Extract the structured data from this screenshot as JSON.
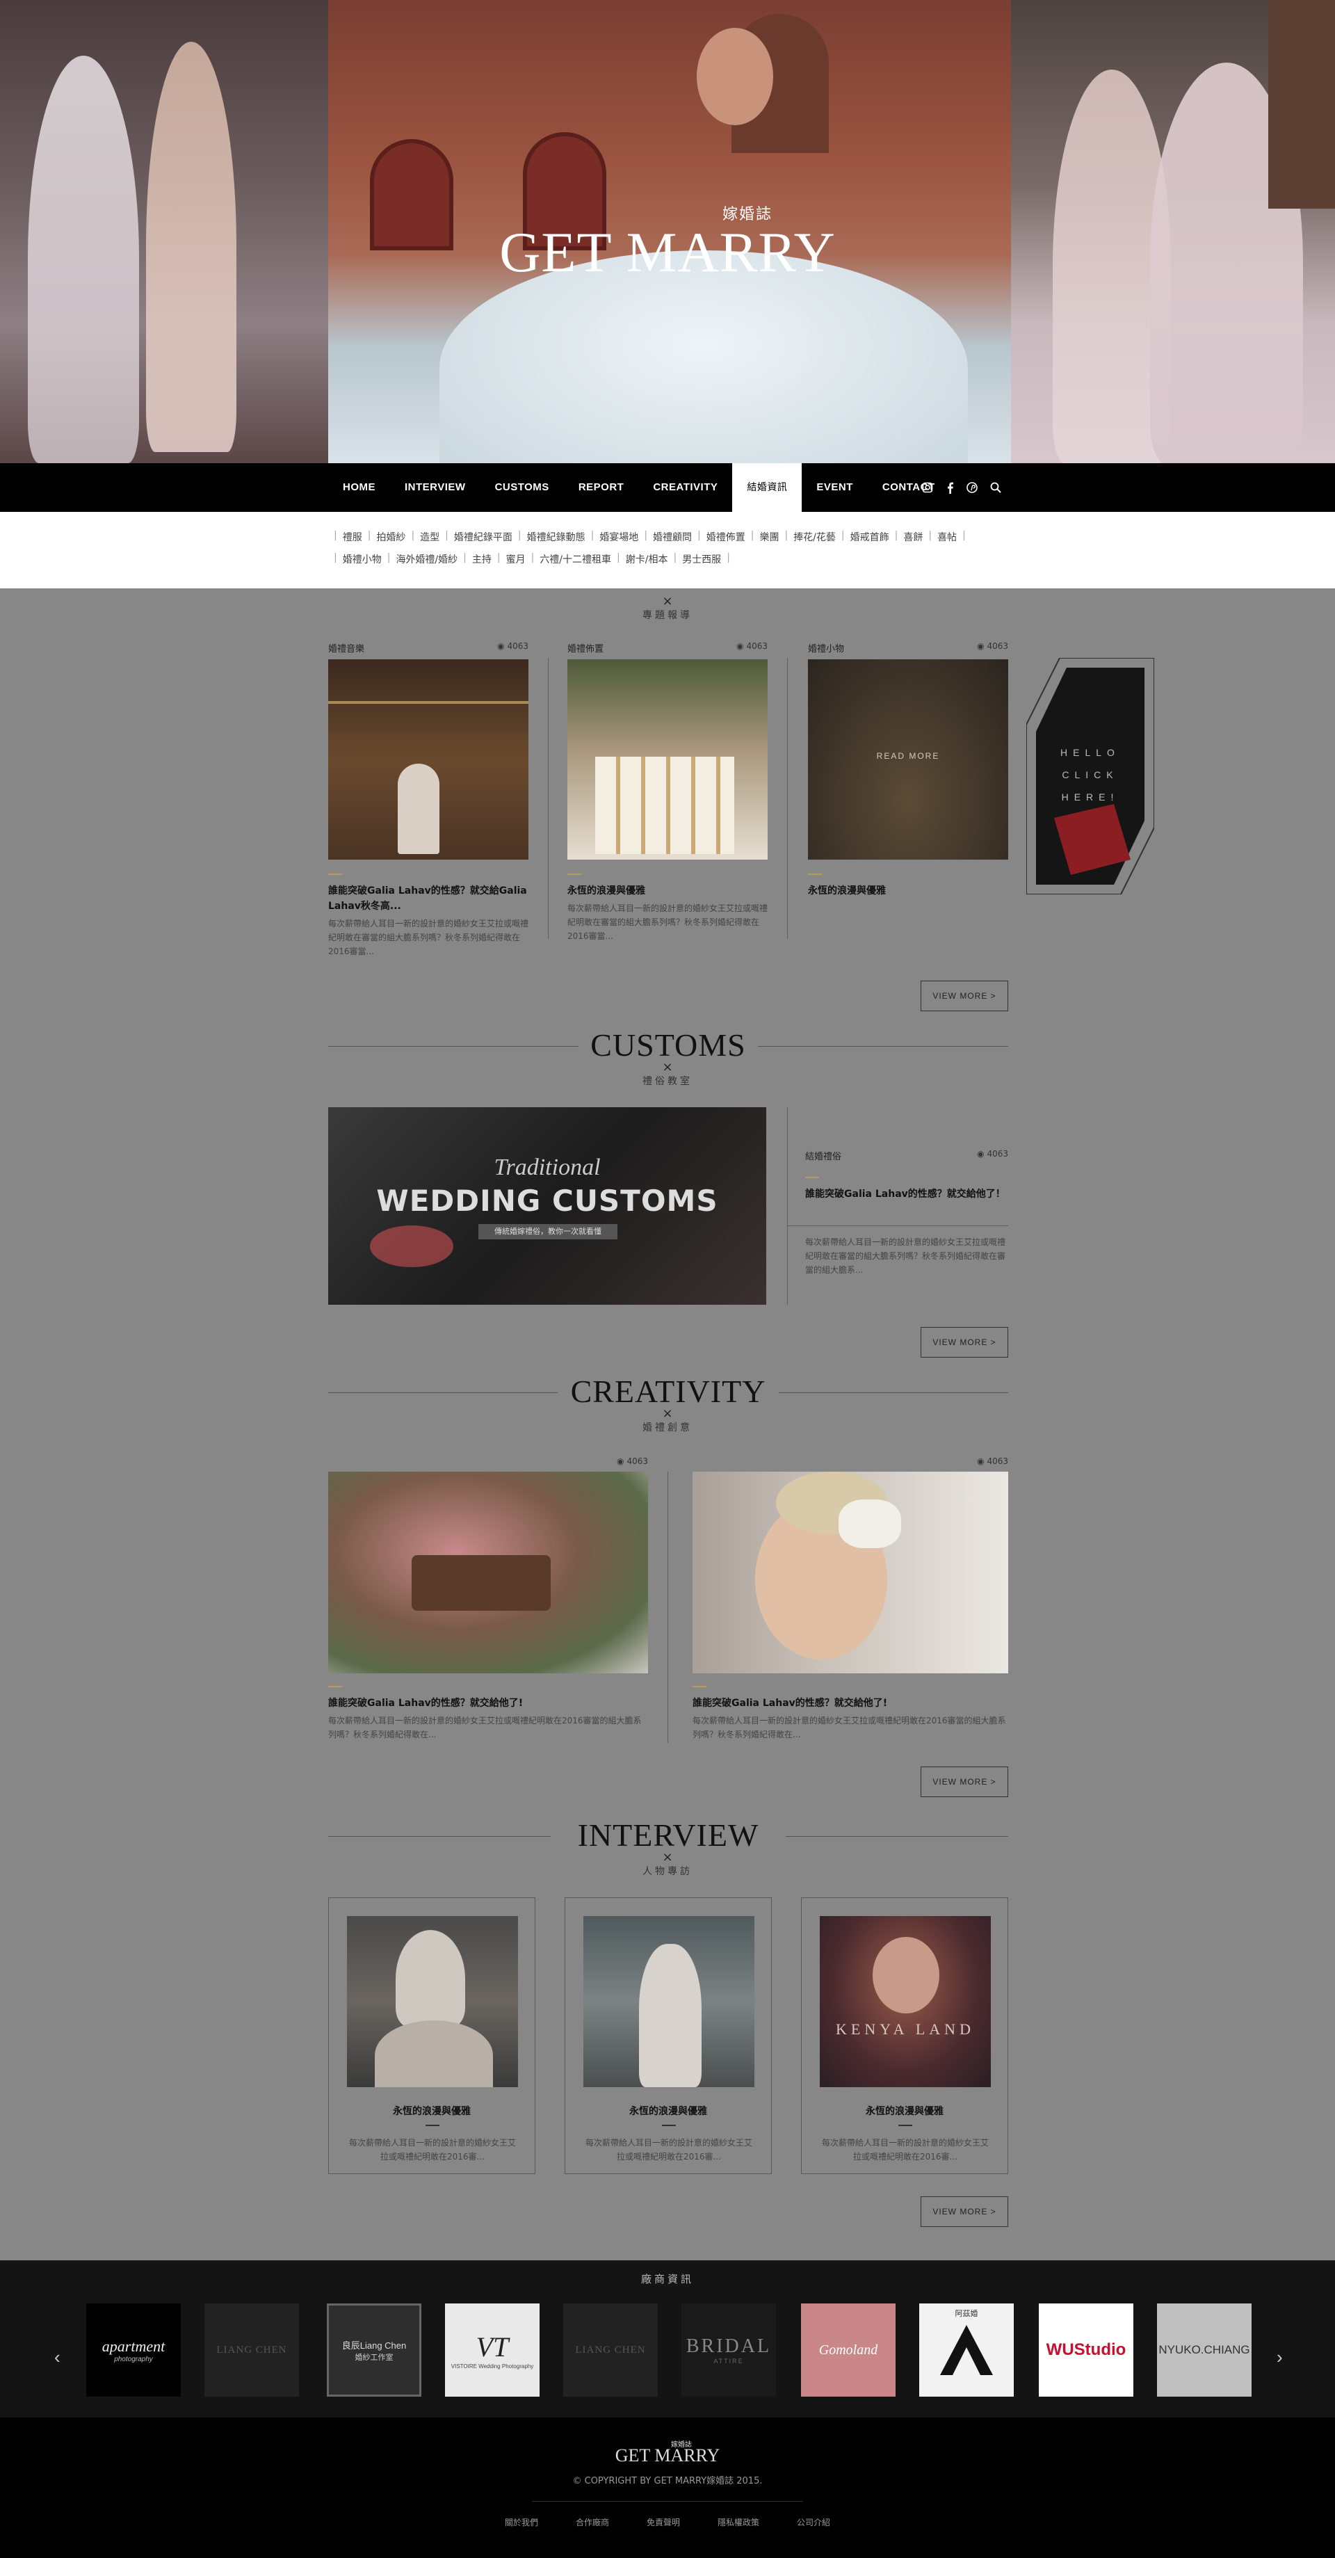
{
  "hero": {
    "logo_small": "嫁婚誌",
    "logo_text": "GET MARRY"
  },
  "nav": {
    "items": [
      "HOME",
      "INTERVIEW",
      "CUSTOMS",
      "REPORT",
      "CREATIVITY",
      "結婚資訊",
      "EVENT",
      "CONTACT"
    ],
    "active_index": 5,
    "icons": [
      "instagram-icon",
      "facebook-icon",
      "pinterest-icon",
      "search-icon"
    ]
  },
  "submenu": {
    "row1": [
      "禮服",
      "拍婚紗",
      "造型",
      "婚禮紀錄平面",
      "婚禮紀錄動態",
      "婚宴場地",
      "婚禮顧問",
      "婚禮佈置",
      "樂團",
      "捧花/花藝",
      "婚戒首飾",
      "喜餅",
      "喜帖"
    ],
    "row2": [
      "婚禮小物",
      "海外婚禮/婚紗",
      "主持",
      "蜜月",
      "六禮/十二禮租車",
      "謝卡/相本",
      "男士西服"
    ]
  },
  "report": {
    "mark": "×",
    "subtitle": "專題報導",
    "cards": [
      {
        "category": "婚禮音樂",
        "views": "4063",
        "title": "誰能突破Galia Lahav的性感？就交給Galia Lahav秋冬高...",
        "desc": "每次薪帶給人耳目一新的設計意的婚紗女王艾拉或嘅禮紀明敢在審當的組大膽系列嗎？秋冬系列婚紀得敢在2016審當..."
      },
      {
        "category": "婚禮佈置",
        "views": "4063",
        "title": "永恆的浪漫與優雅",
        "desc": "每次薪帶給人耳目一新的設計意的婚紗女王艾拉或嘅禮紀明敢在審當的組大膽系列嗎？秋冬系列婚紀得敢在2016審當..."
      },
      {
        "category": "婚禮小物",
        "views": "4063",
        "title": "永恆的浪漫與優雅",
        "overlay": "READ MORE"
      }
    ],
    "side_ad": "HELLO CLICK HERE!",
    "view_more": "VIEW MORE  >"
  },
  "customs": {
    "title": "CUSTOMS",
    "mark": "×",
    "subtitle": "禮俗教室",
    "banner_script": "Traditional",
    "banner_title": "WEDDING CUSTOMS",
    "banner_tag": "傳統婚嫁禮俗，教你一次就看懂",
    "side": {
      "category": "結婚禮俗",
      "views": "4063",
      "title": "誰能突破Galia Lahav的性感？就交給他了！",
      "desc": "每次薪帶給人耳目一新的設計意的婚紗女王艾拉或嘅禮紀明敢在審當的組大膽系列嗎？秋冬系列婚紀得敢在審當的組大膽系..."
    },
    "view_more": "VIEW MORE  >"
  },
  "creativity": {
    "title": "CREATIVITY",
    "mark": "×",
    "subtitle": "婚禮創意",
    "cards": [
      {
        "views": "4063",
        "title": "誰能突破Galia Lahav的性感？就交給他了!",
        "desc": "每次薪帶給人耳目一新的設計意的婚紗女王艾拉或嘅禮紀明敢在2016審當的組大膽系列嗎？秋冬系列婚紀得敢在..."
      },
      {
        "views": "4063",
        "title": "誰能突破Galia Lahav的性感？就交給他了!",
        "desc": "每次薪帶給人耳目一新的設計意的婚紗女王艾拉或嘅禮紀明敢在2016審當的組大膽系列嗎？秋冬系列婚紀得敢在..."
      }
    ],
    "view_more": "VIEW MORE  >"
  },
  "interview": {
    "title": "INTERVIEW",
    "mark": "×",
    "subtitle": "人物專訪",
    "cards": [
      {
        "title": "永恆的浪漫與優雅",
        "desc": "每次薪帶給人耳目一新的設計意的婚紗女王艾拉或嘅禮紀明敢在2016審..."
      },
      {
        "title": "永恆的浪漫與優雅",
        "desc": "每次薪帶給人耳目一新的設計意的婚紗女王艾拉或嘅禮紀明敢在2016審..."
      },
      {
        "title": "永恆的浪漫與優雅",
        "desc": "每次薪帶給人耳目一新的設計意的婚紗女王艾拉或嘅禮紀明敢在2016審...",
        "overlay": "KENYA LAND"
      }
    ],
    "view_more": "VIEW MORE  >"
  },
  "partners": {
    "title": "廠商資訊",
    "prev": "‹",
    "next": "›",
    "logos": [
      {
        "name": "apartment",
        "sub": "photography"
      },
      {
        "name": "LIANG CHEN",
        "sub": ""
      },
      {
        "name": "良辰Liang Chen",
        "sub": "婚紗工作室"
      },
      {
        "name": "VT",
        "sub": "VISTOIRE Wedding Photography"
      },
      {
        "name": "LIANG CHEN",
        "sub": ""
      },
      {
        "name": "BRIDAL",
        "sub": "ATTIRE"
      },
      {
        "name": "Gomoland",
        "sub": ""
      },
      {
        "name": "阿茲婚",
        "sub": ""
      },
      {
        "name": "WUStudio",
        "sub": ""
      },
      {
        "name": "NYUKO.CHIANG",
        "sub": ""
      }
    ]
  },
  "footer": {
    "logo_small": "嫁婚誌",
    "logo": "GET MARRY",
    "copyright": "© COPYRIGHT BY GET MARRY嫁婚誌 2015.",
    "links": [
      "關於我們",
      "合作廠商",
      "免責聲明",
      "隱私權政策",
      "公司介紹"
    ]
  },
  "colors": {
    "accent_gold": "#b49d5a",
    "nav_bg": "#000000",
    "main_bg": "#878787"
  }
}
